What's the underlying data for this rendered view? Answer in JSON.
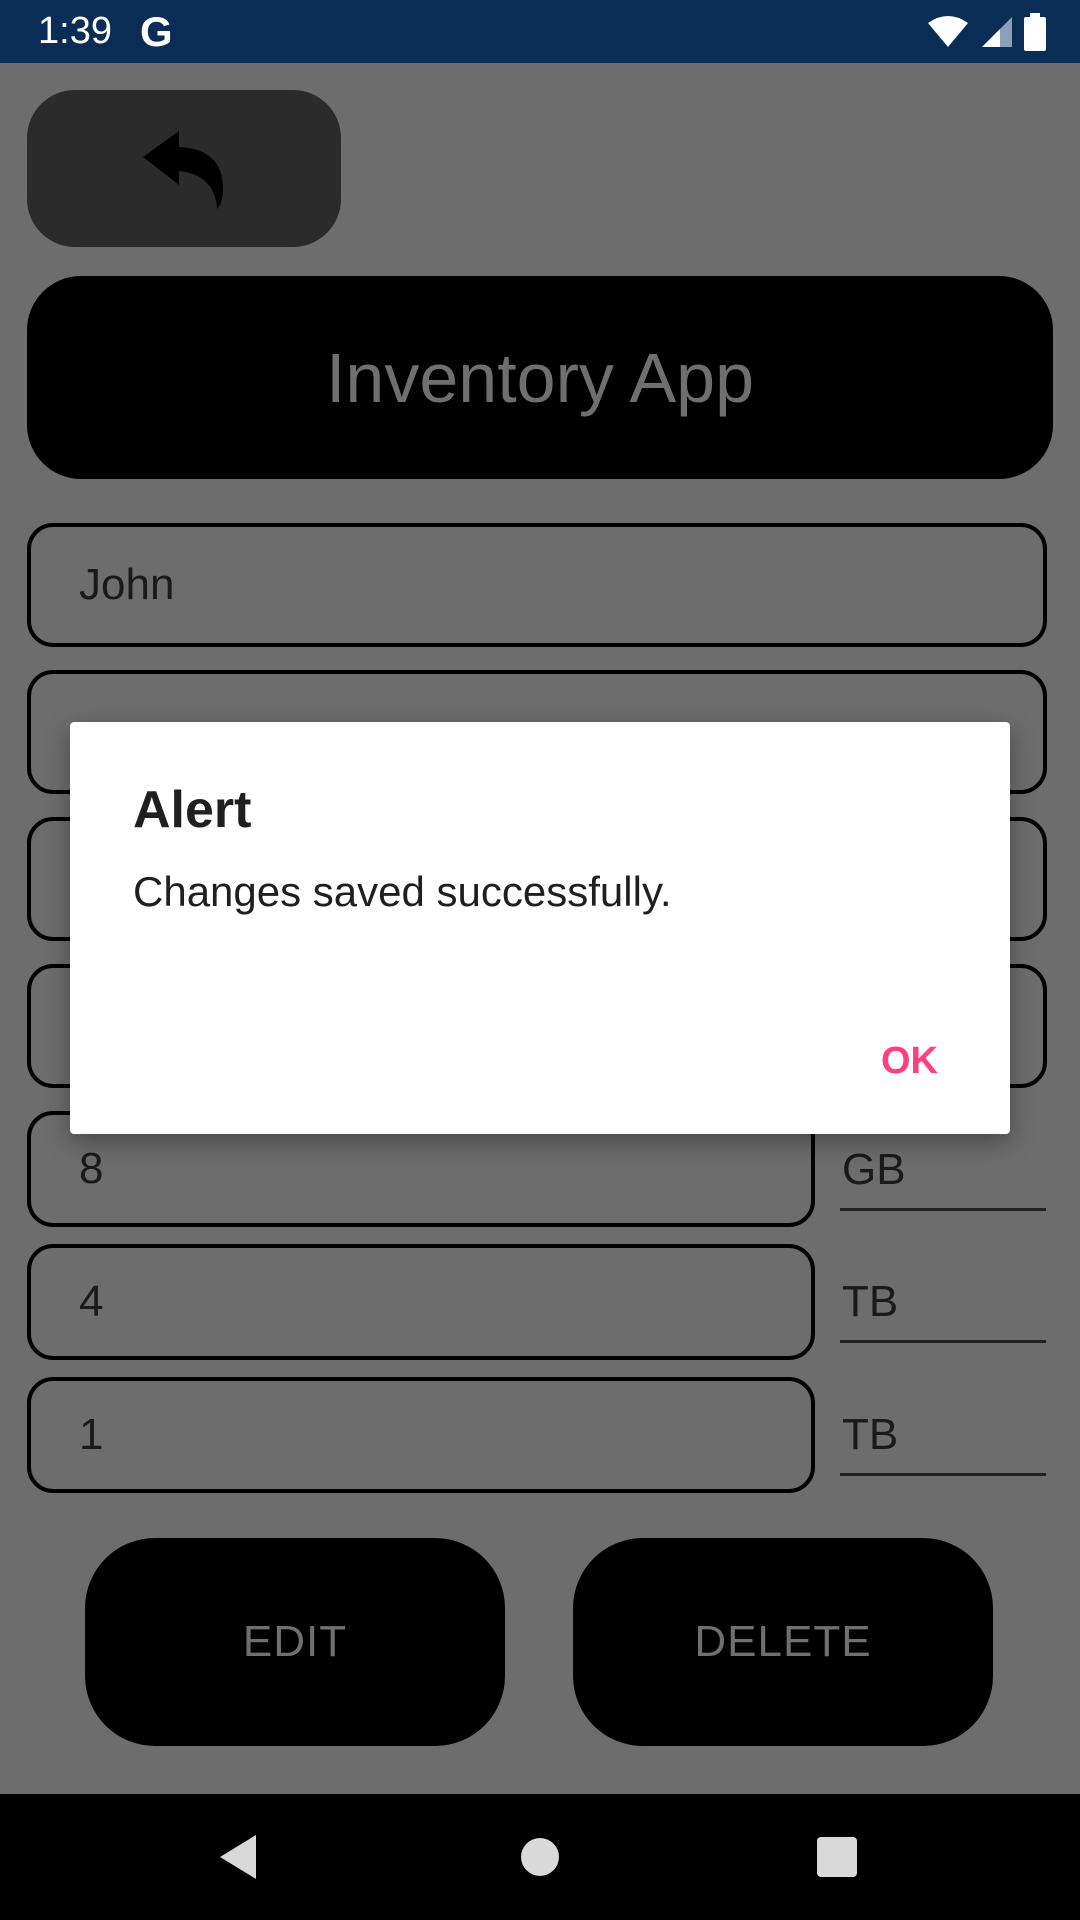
{
  "status_bar": {
    "time": "1:39",
    "google_icon": "G",
    "icons": [
      "wifi-icon",
      "cellular-signal-icon",
      "battery-icon"
    ]
  },
  "app": {
    "back_icon": "undo-arrow-icon",
    "title": "Inventory App",
    "fields": [
      {
        "value": "John"
      },
      {
        "value": ""
      },
      {
        "value": ""
      },
      {
        "value": ""
      }
    ],
    "capacity_fields": [
      {
        "value": "8",
        "unit": "GB"
      },
      {
        "value": "4",
        "unit": "TB"
      },
      {
        "value": "1",
        "unit": "TB"
      }
    ],
    "buttons": {
      "edit": "EDIT",
      "delete": "DELETE"
    }
  },
  "dialog": {
    "title": "Alert",
    "message": "Changes saved successfully.",
    "ok_label": "OK"
  },
  "nav_bar": {
    "icons": [
      "back-triangle-icon",
      "home-circle-icon",
      "recents-square-icon"
    ]
  },
  "colors": {
    "status_bar": "#0a2d56",
    "dimmed_background": "#6d6d6d",
    "accent": "#ff3f80"
  }
}
